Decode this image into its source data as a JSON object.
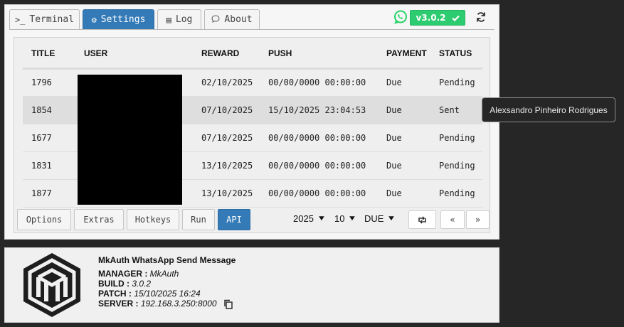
{
  "tabs": [
    {
      "label": "Terminal",
      "icon": "terminal-icon"
    },
    {
      "label": "Settings",
      "icon": "gears-icon",
      "active": true
    },
    {
      "label": "Log",
      "icon": "list-icon"
    },
    {
      "label": "About",
      "icon": "comment-icon"
    }
  ],
  "header": {
    "version": "v3.0.2",
    "status_icon": "check-icon",
    "whatsapp_color": "#25d366",
    "badge_color": "#2ecc71"
  },
  "table": {
    "columns": [
      "TITLE",
      "USER",
      "REWARD",
      "PUSH",
      "PAYMENT",
      "STATUS"
    ],
    "rows": [
      {
        "title": "1796",
        "reward": "02/10/2025",
        "push": "00/00/0000 00:00:00",
        "payment": "Due",
        "status": "Pending"
      },
      {
        "title": "1854",
        "reward": "07/10/2025",
        "push": "15/10/2025 23:04:53",
        "payment": "Due",
        "status": "Sent"
      },
      {
        "title": "1677",
        "reward": "07/10/2025",
        "push": "00/00/0000 00:00:00",
        "payment": "Due",
        "status": "Pending"
      },
      {
        "title": "1831",
        "reward": "13/10/2025",
        "push": "00/00/0000 00:00:00",
        "payment": "Due",
        "status": "Pending"
      },
      {
        "title": "1877",
        "reward": "13/10/2025",
        "push": "00/00/0000 00:00:00",
        "payment": "Due",
        "status": "Pending"
      }
    ]
  },
  "tooltip": "Alexsandro Pinheiro Rodrigues",
  "bottom": {
    "buttons": [
      "Options",
      "Extras",
      "Hotkeys",
      "Run",
      "API"
    ],
    "active_button": "API",
    "year": "2025",
    "month": "10",
    "filter": "DUE",
    "nav_prev": "«",
    "nav_next": "»"
  },
  "info": {
    "title": "MkAuth WhatsApp Send Message",
    "manager_label": "MANAGER :",
    "manager": "MkAuth",
    "build_label": "BUILD :",
    "build": "3.0.2",
    "patch_label": "PATCH :",
    "patch": "15/10/2025 16:24",
    "server_label": "SERVER :",
    "server": "192.168.3.250:8000"
  }
}
